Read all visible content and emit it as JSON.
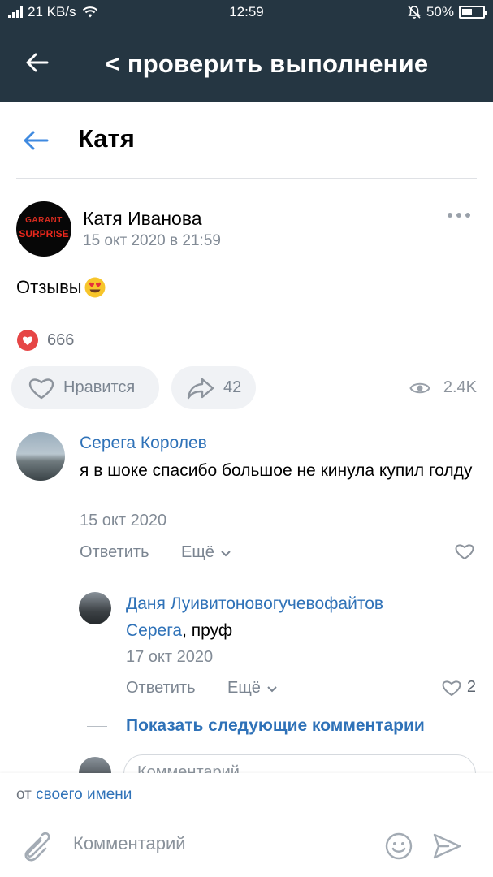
{
  "status_bar": {
    "speed": "21 KB/s",
    "time": "12:59",
    "battery": "50%",
    "battery_level": 0.5
  },
  "header": {
    "back_icon": "arrow-left-icon",
    "title": "< проверить выполнение"
  },
  "sub_header": {
    "back_icon": "arrow-left-icon",
    "name": "Катя"
  },
  "post": {
    "avatar_line1": "GARANT",
    "avatar_line2": "SURPRISE",
    "author": "Катя Иванова",
    "date": "15 окт 2020 в 21:59",
    "text": "Отзывы",
    "emoji": "heart-eyes-emoji-icon",
    "likes_count": "666",
    "like_button_label": "Нравится",
    "share_count": "42",
    "views": "2.4K"
  },
  "comments": [
    {
      "author": "Серега Королев",
      "text": "я в шоке спасибо большое не кинула купил голду",
      "date": "15 окт 2020",
      "reply_label": "Ответить",
      "more_label": "Ещё",
      "likes": ""
    },
    {
      "author": "Даня Луивитоновогучевофайтов",
      "mention": "Серега",
      "text": ", пруф",
      "date": "17 окт 2020",
      "reply_label": "Ответить",
      "more_label": "Ещё",
      "likes": "2"
    }
  ],
  "show_more_label": "Показать следующие комментарии",
  "inline_comment_placeholder": "Комментарий",
  "composer": {
    "from_prefix": "от ",
    "from_name": "своего имени",
    "placeholder": "Комментарий"
  },
  "colors": {
    "header_bg": "#253642",
    "link": "#2f72b8",
    "like_red": "#e64646",
    "secondary_text": "#828b96"
  }
}
